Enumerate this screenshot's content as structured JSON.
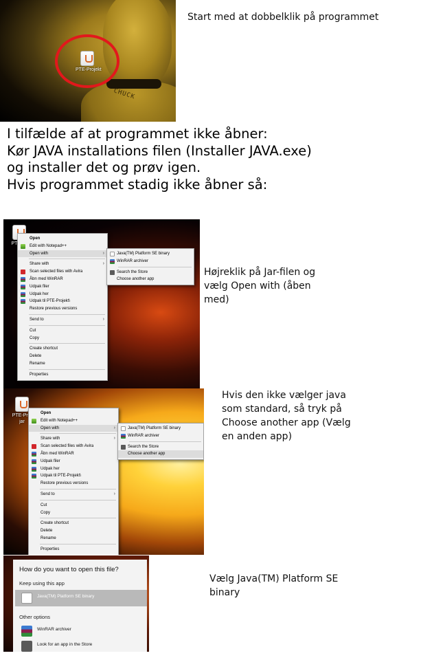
{
  "step1": {
    "caption": "Start med at dobbelklik på programmet",
    "desktop_icon_label": "PTE-Projekt",
    "figure_stamp": "CHUCK"
  },
  "notice": {
    "line1": "I tilfælde af at programmet ikke åbner:",
    "line2": "Kør JAVA installations filen (Installer JAVA.exe)",
    "line3": "og installer det og prøv igen.",
    "line4": "Hvis programmet stadig ikke åbner så:"
  },
  "step2": {
    "caption_lines": [
      "Højreklik på Jar-filen og",
      "vælg Open with (åben",
      "med)"
    ],
    "desktop_icon_label": "PTE-Pr",
    "menu": [
      {
        "label": "Open",
        "icon": "none",
        "bold": true
      },
      {
        "label": "Edit with Notepad++",
        "icon": "notepad-icon"
      },
      {
        "label": "Open with",
        "icon": "none",
        "submenu": true,
        "highlight": true
      },
      {
        "sep": true
      },
      {
        "label": "Share with",
        "icon": "none",
        "submenu": true
      },
      {
        "label": "Scan selected files with Avira",
        "icon": "avira-icon"
      },
      {
        "label": "Åbn med WinRAR",
        "icon": "winrar-icon"
      },
      {
        "label": "Udpak filer",
        "icon": "winrar-icon"
      },
      {
        "label": "Udpak her",
        "icon": "winrar-icon"
      },
      {
        "label": "Udpak til PTE-Projekt\\",
        "icon": "winrar-icon"
      },
      {
        "label": "Restore previous versions",
        "icon": "none"
      },
      {
        "sep": true
      },
      {
        "label": "Send to",
        "icon": "none",
        "submenu": true
      },
      {
        "sep": true
      },
      {
        "label": "Cut",
        "icon": "none"
      },
      {
        "label": "Copy",
        "icon": "none"
      },
      {
        "sep": true
      },
      {
        "label": "Create shortcut",
        "icon": "none"
      },
      {
        "label": "Delete",
        "icon": "none"
      },
      {
        "label": "Rename",
        "icon": "none"
      },
      {
        "sep": true
      },
      {
        "label": "Properties",
        "icon": "none"
      }
    ],
    "submenu": [
      {
        "label": "Java(TM) Platform SE binary",
        "icon": "java-icon"
      },
      {
        "label": "WinRAR archiver",
        "icon": "winrar-icon"
      },
      {
        "sep": true
      },
      {
        "label": "Search the Store",
        "icon": "store-icon"
      },
      {
        "label": "Choose another app",
        "icon": "none"
      }
    ]
  },
  "step3": {
    "caption_lines": [
      "Hvis den ikke vælger java",
      "som standard, så tryk på",
      "Choose another app (Vælg",
      "en anden app)"
    ],
    "desktop_icon_label": "PTE-Proj",
    "desktop_icon_sub": "jar",
    "highlighted_submenu_item": "Choose another app"
  },
  "step4": {
    "caption_lines": [
      "Vælg Java(TM) Platform SE",
      "binary"
    ],
    "dialog_title": "How do you want to open this file?",
    "keep_label": "Keep using this app",
    "selected_app": "Java(TM) Platform SE binary",
    "other_label": "Other options",
    "options": [
      {
        "label": "WinRAR archiver",
        "icon": "winrar-icon"
      },
      {
        "label": "Look for an app in the Store",
        "icon": "store-icon"
      }
    ]
  },
  "colors": {
    "java_orange": "#d9682a",
    "winrar_red": "#8b1d4e",
    "avira_red": "#d2262b",
    "store_gray": "#5a5a5a",
    "ring_red": "#e2181c"
  }
}
